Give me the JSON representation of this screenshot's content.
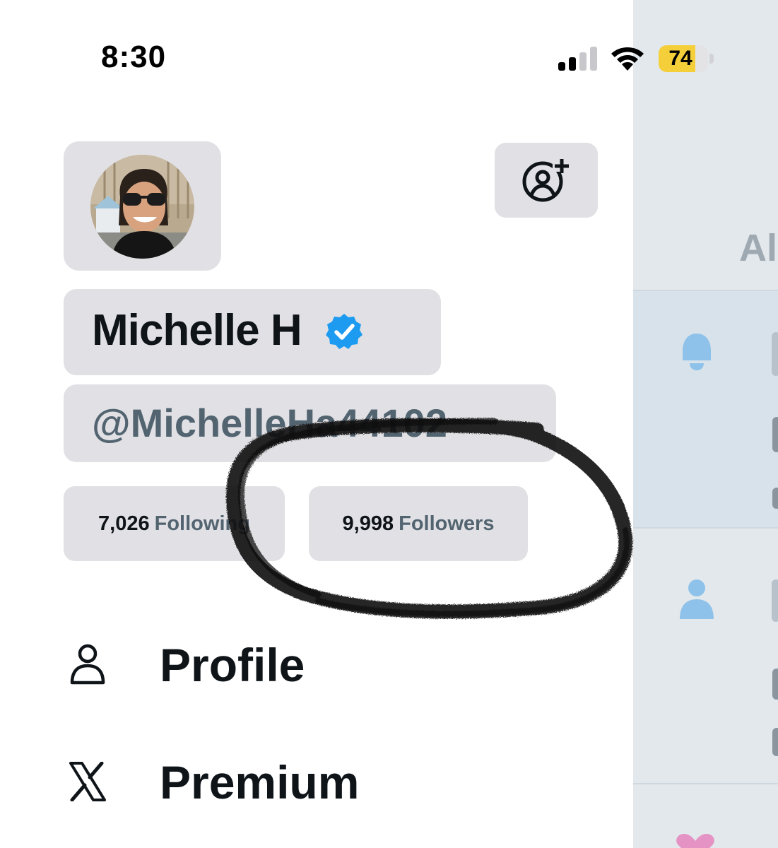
{
  "status_bar": {
    "time": "8:30",
    "battery_percent": "74",
    "battery_level": 0.74,
    "signal_bars_active": 2,
    "battery_color": "#f5cf3a"
  },
  "drawer": {
    "display_name": "Michelle H",
    "handle": "@MichelleHa44102",
    "following_count": "7,026",
    "following_label": "Following",
    "followers_count": "9,998",
    "followers_label": "Followers",
    "menu": [
      {
        "label": "Profile",
        "icon": "person-icon"
      },
      {
        "label": "Premium",
        "icon": "x-logo-icon"
      }
    ]
  },
  "background_timeline": {
    "tab_label_fragment": "Al"
  },
  "colors": {
    "placeholder_gray": "#e1e1e5",
    "verified_blue": "#1d9bf0",
    "secondary_text": "#536471",
    "timeline_icon_blue": "#8ec2ea"
  }
}
